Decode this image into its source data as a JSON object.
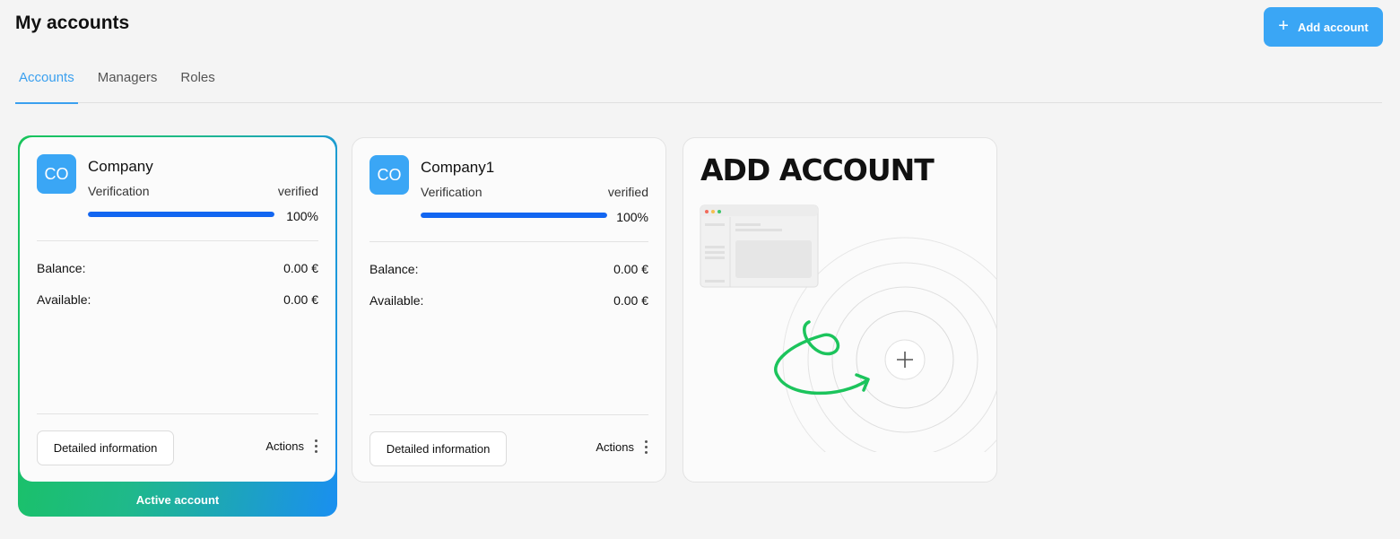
{
  "header": {
    "title": "My accounts",
    "add_button_label": "Add account"
  },
  "tabs": [
    {
      "label": "Accounts",
      "active": true
    },
    {
      "label": "Managers",
      "active": false
    },
    {
      "label": "Roles",
      "active": false
    }
  ],
  "accounts": [
    {
      "initials": "CO",
      "name": "Company",
      "verification_label": "Verification",
      "verification_status": "verified",
      "progress_text": "100%",
      "progress": 1.0,
      "balance_label": "Balance:",
      "balance_value": "0.00 €",
      "available_label": "Available:",
      "available_value": "0.00 €",
      "detail_button": "Detailed information",
      "actions_label": "Actions",
      "active_label": "Active account"
    },
    {
      "initials": "CO",
      "name": "Company1",
      "verification_label": "Verification",
      "verification_status": "verified",
      "progress_text": "100%",
      "progress": 1.0,
      "balance_label": "Balance:",
      "balance_value": "0.00 €",
      "available_label": "Available:",
      "available_value": "0.00 €",
      "detail_button": "Detailed information",
      "actions_label": "Actions"
    }
  ],
  "add_card": {
    "title": "ADD ACCOUNT"
  },
  "colors": {
    "accent": "#3aa6f5",
    "progress": "#1266f1",
    "active_gradient_start": "#18c45a",
    "active_gradient_end": "#1a8ff0",
    "swirl": "#1cc45c"
  },
  "icons": {
    "add_button": "plus-icon",
    "actions": "kebab-menu-icon",
    "add_card_center": "plus-circle-icon"
  }
}
